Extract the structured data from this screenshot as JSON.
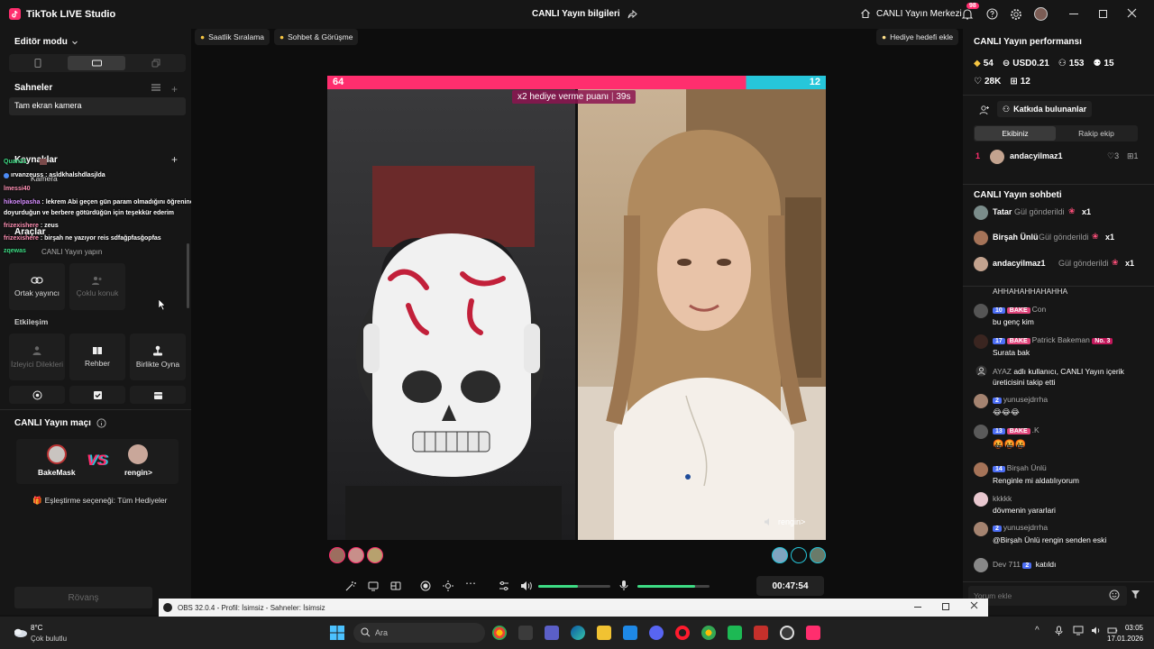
{
  "app": {
    "title": "TikTok LIVE Studio",
    "center_title": "CANLI Yayın bilgileri",
    "live_center": "CANLI Yayın Merkezi",
    "notif_count": "98"
  },
  "left": {
    "editor_mode": "Editör modu",
    "scenes_title": "Sahneler",
    "scene_item": "Tam ekran kamera",
    "sources_title": "Kaynaklar",
    "source_item": "Kamera",
    "tools_title": "Araçlar",
    "go_live_label": "CANLI Yayın yapın",
    "tools": [
      {
        "label": "Ortak yayıncı",
        "icon": "link-icon"
      },
      {
        "label": "Çoklu konuk",
        "icon": "guests-icon"
      }
    ],
    "interaction_title": "Etkileşim",
    "interaction_tiles": [
      {
        "label": "İzleyici Dilekleri",
        "icon": "wish-icon"
      },
      {
        "label": "Rehber",
        "icon": "book-icon"
      },
      {
        "label": "Birlikte Oyna",
        "icon": "joystick-icon"
      }
    ],
    "match_title": "CANLI Yayın maçı",
    "player_left": "BakeMask",
    "player_right": "rengin>",
    "vs": "VS",
    "pairing": "Eşleştirme seçeneği: Tüm Hediyeler",
    "rematch": "Rövanş"
  },
  "overlay_chat": [
    {
      "user": "Quan21",
      "text": ""
    },
    {
      "user": "",
      "text": "ırvanzeuss : asldkhalshdlasjlda"
    },
    {
      "user": "lmessi40",
      "text": ""
    },
    {
      "user": "hikoelpasha",
      "text": "lekrem Abi geçen gün param olmadığını öğrenince beşyüz dolar para gönderip karnımı"
    },
    {
      "user": "",
      "text": "doyurduğun ve berbere götürdüğün için teşekkür ederim"
    },
    {
      "user": "frizexishere",
      "text": "zeus"
    },
    {
      "user": "frizexishere",
      "text": "birşah ne yazıyor reis sdfağpfasğopfas"
    },
    {
      "user": "zqewas",
      "text": ""
    }
  ],
  "stage": {
    "chip_ranking": "Saatlik Sıralama",
    "chip_chat": "Sohbet & Görüşme",
    "gift_goal": "Hediye hedefi ekle",
    "score_left": "64",
    "score_right": "12",
    "multiplier": "x2 hediye verme puanı",
    "multiplier_time": "39s",
    "right_name_tag": "rengin>",
    "timer": "00:47:54",
    "mic_level_pct": 80,
    "volume_level_pct": 55
  },
  "right": {
    "perf_title": "CANLI Yayın performansı",
    "stats": [
      {
        "icon": "diamond-icon",
        "value": "54"
      },
      {
        "icon": "coin-icon",
        "value": "USD0.21"
      },
      {
        "icon": "viewers-icon",
        "value": "153"
      },
      {
        "icon": "follow-icon",
        "value": "15"
      },
      {
        "icon": "heart-icon",
        "value": "28K"
      },
      {
        "icon": "gift-icon",
        "value": "12"
      }
    ],
    "contributors_label": "Katkıda bulunanlar",
    "tab_our": "Ekibiniz",
    "tab_rival": "Rakip ekip",
    "top_contributor": {
      "rank": "1",
      "name": "andacyilmaz1",
      "hearts": "3",
      "gifts": "1"
    },
    "chat_title": "CANLI Yayın sohbeti",
    "pinned_gifts": [
      {
        "name": "Tatar",
        "action": "Gül gönderildi",
        "count": "x1"
      },
      {
        "name": "Birşah Ünlü",
        "action": "Gül gönderildi",
        "count": "x1"
      },
      {
        "name": "andacyilmaz1",
        "action": "Gül gönderildi",
        "count": "x1"
      }
    ],
    "messages": [
      {
        "level": "",
        "fan": "",
        "name": "",
        "text": "AHHAHAHHAHAHHA"
      },
      {
        "level": "10",
        "fan": "BAKE",
        "name": "Con",
        "text": "bu genç kim"
      },
      {
        "level": "17",
        "fan": "BAKE",
        "name": "Patrick Bakeman",
        "badge": "No. 3",
        "text": "Surata bak"
      },
      {
        "level": "",
        "fan": "",
        "name": "AYAZ",
        "text": "adlı kullanıcı, CANLI Yayın içerik üreticisini takip etti"
      },
      {
        "level": "2",
        "fan": "",
        "name": "yunusejdrrha",
        "text": "😂😂😂"
      },
      {
        "level": "13",
        "fan": "BAKE",
        "name": ".K",
        "text": "🤬🤬🤬"
      },
      {
        "level": "14",
        "fan": "",
        "name": "Birşah Ünlü",
        "text": "Renginle mi aldatılıyorum"
      },
      {
        "level": "",
        "fan": "",
        "name": "kkkkk",
        "text": "dövmenin yararlari"
      },
      {
        "level": "2",
        "fan": "",
        "name": "yunusejdrrha",
        "text": "@Birşah Ünlü rengin senden eski"
      },
      {
        "level": "2",
        "fan": "",
        "name": "Dev 711",
        "text": "katıldı"
      }
    ],
    "comment_placeholder": "Yorum ekle"
  },
  "obs": {
    "title": "OBS 32.0.4 - Profil: İsimsiz - Sahneler: İsimsiz"
  },
  "taskbar": {
    "weather_temp": "8°C",
    "weather_desc": "Çok bulutlu",
    "search_placeholder": "Ara",
    "time": "03:05",
    "date": "17.01.2026"
  },
  "colors": {
    "accent": "#ff2e6e",
    "teal": "#26c6da",
    "green": "#3ddc84",
    "panel": "#161616"
  }
}
